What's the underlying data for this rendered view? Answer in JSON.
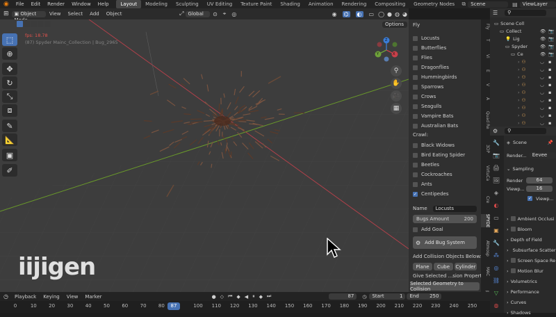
{
  "topbar": {
    "menus": [
      "File",
      "Edit",
      "Render",
      "Window",
      "Help"
    ],
    "workspaces": [
      "Layout",
      "Modeling",
      "Sculpting",
      "UV Editing",
      "Texture Paint",
      "Shading",
      "Animation",
      "Rendering",
      "Compositing",
      "Geometry Nodes"
    ],
    "active_workspace": "Layout",
    "scene": "Scene",
    "view_layer": "ViewLayer"
  },
  "viewport_header": {
    "mode": "Object Mode",
    "menus": [
      "View",
      "Select",
      "Add",
      "Object"
    ],
    "orientation": "Global",
    "options": "Options"
  },
  "viewport": {
    "fps": "fps: 18.78",
    "context": "(87) Spyder Mainc_Collection | Bug_2965",
    "watermark": "iijigen",
    "gizmo": {
      "x": "X",
      "y": "Y",
      "z": "Z"
    }
  },
  "npanel": {
    "header_partial": "Fly",
    "fly_items": [
      "Locusts",
      "Butterflies",
      "Flies",
      "Dragonflies",
      "Hummingbirds",
      "Sparrows",
      "Crows",
      "Seagulls",
      "Vampire Bats",
      "Australian Bats"
    ],
    "crawl_label": "Crawl:",
    "crawl_items": [
      "Black Widows",
      "Bird Eating Spider",
      "Beetles",
      "Cockroaches",
      "Ants",
      "Centipedes"
    ],
    "crawl_checked": "Centipedes",
    "name_label": "Name",
    "name_value": "Locusts",
    "bugs_amount_label": "Bugs Amount",
    "bugs_amount_value": "200",
    "add_goal": "Add Goal",
    "add_bug_system": "Add Bug System",
    "collision_label": "Add Collision Objects Below:",
    "collision_buttons": [
      "Plane",
      "Cube",
      "Cylinder"
    ],
    "give_selected": "Give Selected ...sion Properties:",
    "selected_geometry": "Selected Geometry to Collision"
  },
  "npanel_tabs": [
    "Fly",
    "T",
    "Vi",
    "E",
    "V",
    "A",
    "Quad Re",
    "3DP",
    "VirtuCa",
    "Cre",
    "SPYDE",
    "Atmosp",
    "MAC",
    "polyg"
  ],
  "outliner": {
    "rows": [
      "Scene Coll",
      "Collect",
      "Lig",
      "Spyder",
      "Ce"
    ]
  },
  "properties": {
    "scene": "Scene",
    "render_label": "Render...",
    "engine": "Eevee",
    "sampling": "Sampling",
    "render": "Render",
    "render_value": "64",
    "viewport": "Viewp...",
    "viewport_value": "16",
    "viewport_denoise": "Viewp...",
    "sections": [
      "Ambient Occlusi",
      "Bloom",
      "Depth of Field",
      "Subsurface Scatteri",
      "Screen Space Re",
      "Motion Blur",
      "Volumetrics",
      "Performance",
      "Curves",
      "Shadows"
    ]
  },
  "timeline": {
    "menus": [
      "Playback",
      "Keying",
      "View",
      "Marker"
    ],
    "current_frame": "87",
    "start_label": "Start",
    "start_value": "1",
    "end_label": "End",
    "end_value": "250",
    "ticks": [
      "0",
      "10",
      "20",
      "30",
      "40",
      "50",
      "60",
      "70",
      "80",
      "90",
      "100",
      "110",
      "120",
      "130",
      "140",
      "150",
      "160",
      "170",
      "180",
      "190",
      "200",
      "210",
      "220",
      "230",
      "240",
      "250"
    ]
  },
  "colors": {
    "accent": "#4772b3",
    "x_axis": "#b0404a",
    "y_axis": "#6a9a2a",
    "viewport_bg": "#3d3d3d",
    "frame": "#4772b3"
  }
}
